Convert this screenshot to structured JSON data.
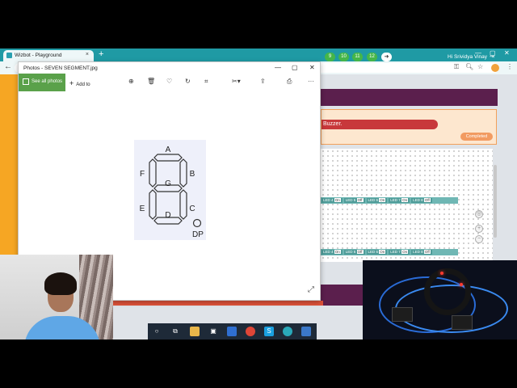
{
  "browser": {
    "tab_title": "Wizbot - Playground",
    "tab_close": "×",
    "new_tab": "+",
    "back": "←",
    "win_min": "—",
    "win_max": "▢",
    "win_close": "✕"
  },
  "playground": {
    "lesson_buttons": [
      "9",
      "10",
      "11",
      "12"
    ],
    "next_arrow": "➜",
    "greeting": "Hi Srividya Vinay",
    "task_text": "Buzzer.",
    "status": "Completed",
    "led_rows": [
      [
        {
          "label": "LED 4",
          "state": "On"
        },
        {
          "label": "LED 5",
          "state": "Off"
        },
        {
          "label": "LED 6",
          "state": "On"
        },
        {
          "label": "LED 7",
          "state": "On"
        },
        {
          "label": "LED 8",
          "state": "Off"
        }
      ],
      [
        {
          "label": "LED 4",
          "state": "On"
        },
        {
          "label": "LED 5",
          "state": "Off"
        },
        {
          "label": "LED 6",
          "state": "On"
        },
        {
          "label": "LED 7",
          "state": "On"
        },
        {
          "label": "LED 8",
          "state": "Off"
        }
      ]
    ]
  },
  "photos": {
    "title": "Photos - SEVEN SEGMENT.jpg",
    "see_all": "See all photos",
    "add_to": "Add to",
    "more": "···",
    "segments": [
      "A",
      "B",
      "C",
      "D",
      "E",
      "F",
      "G",
      "DP"
    ]
  },
  "colors": {
    "accent": "#5b1f4d",
    "chrome": "#1f9aa4",
    "green": "#45b649",
    "task": "#c8383b"
  }
}
